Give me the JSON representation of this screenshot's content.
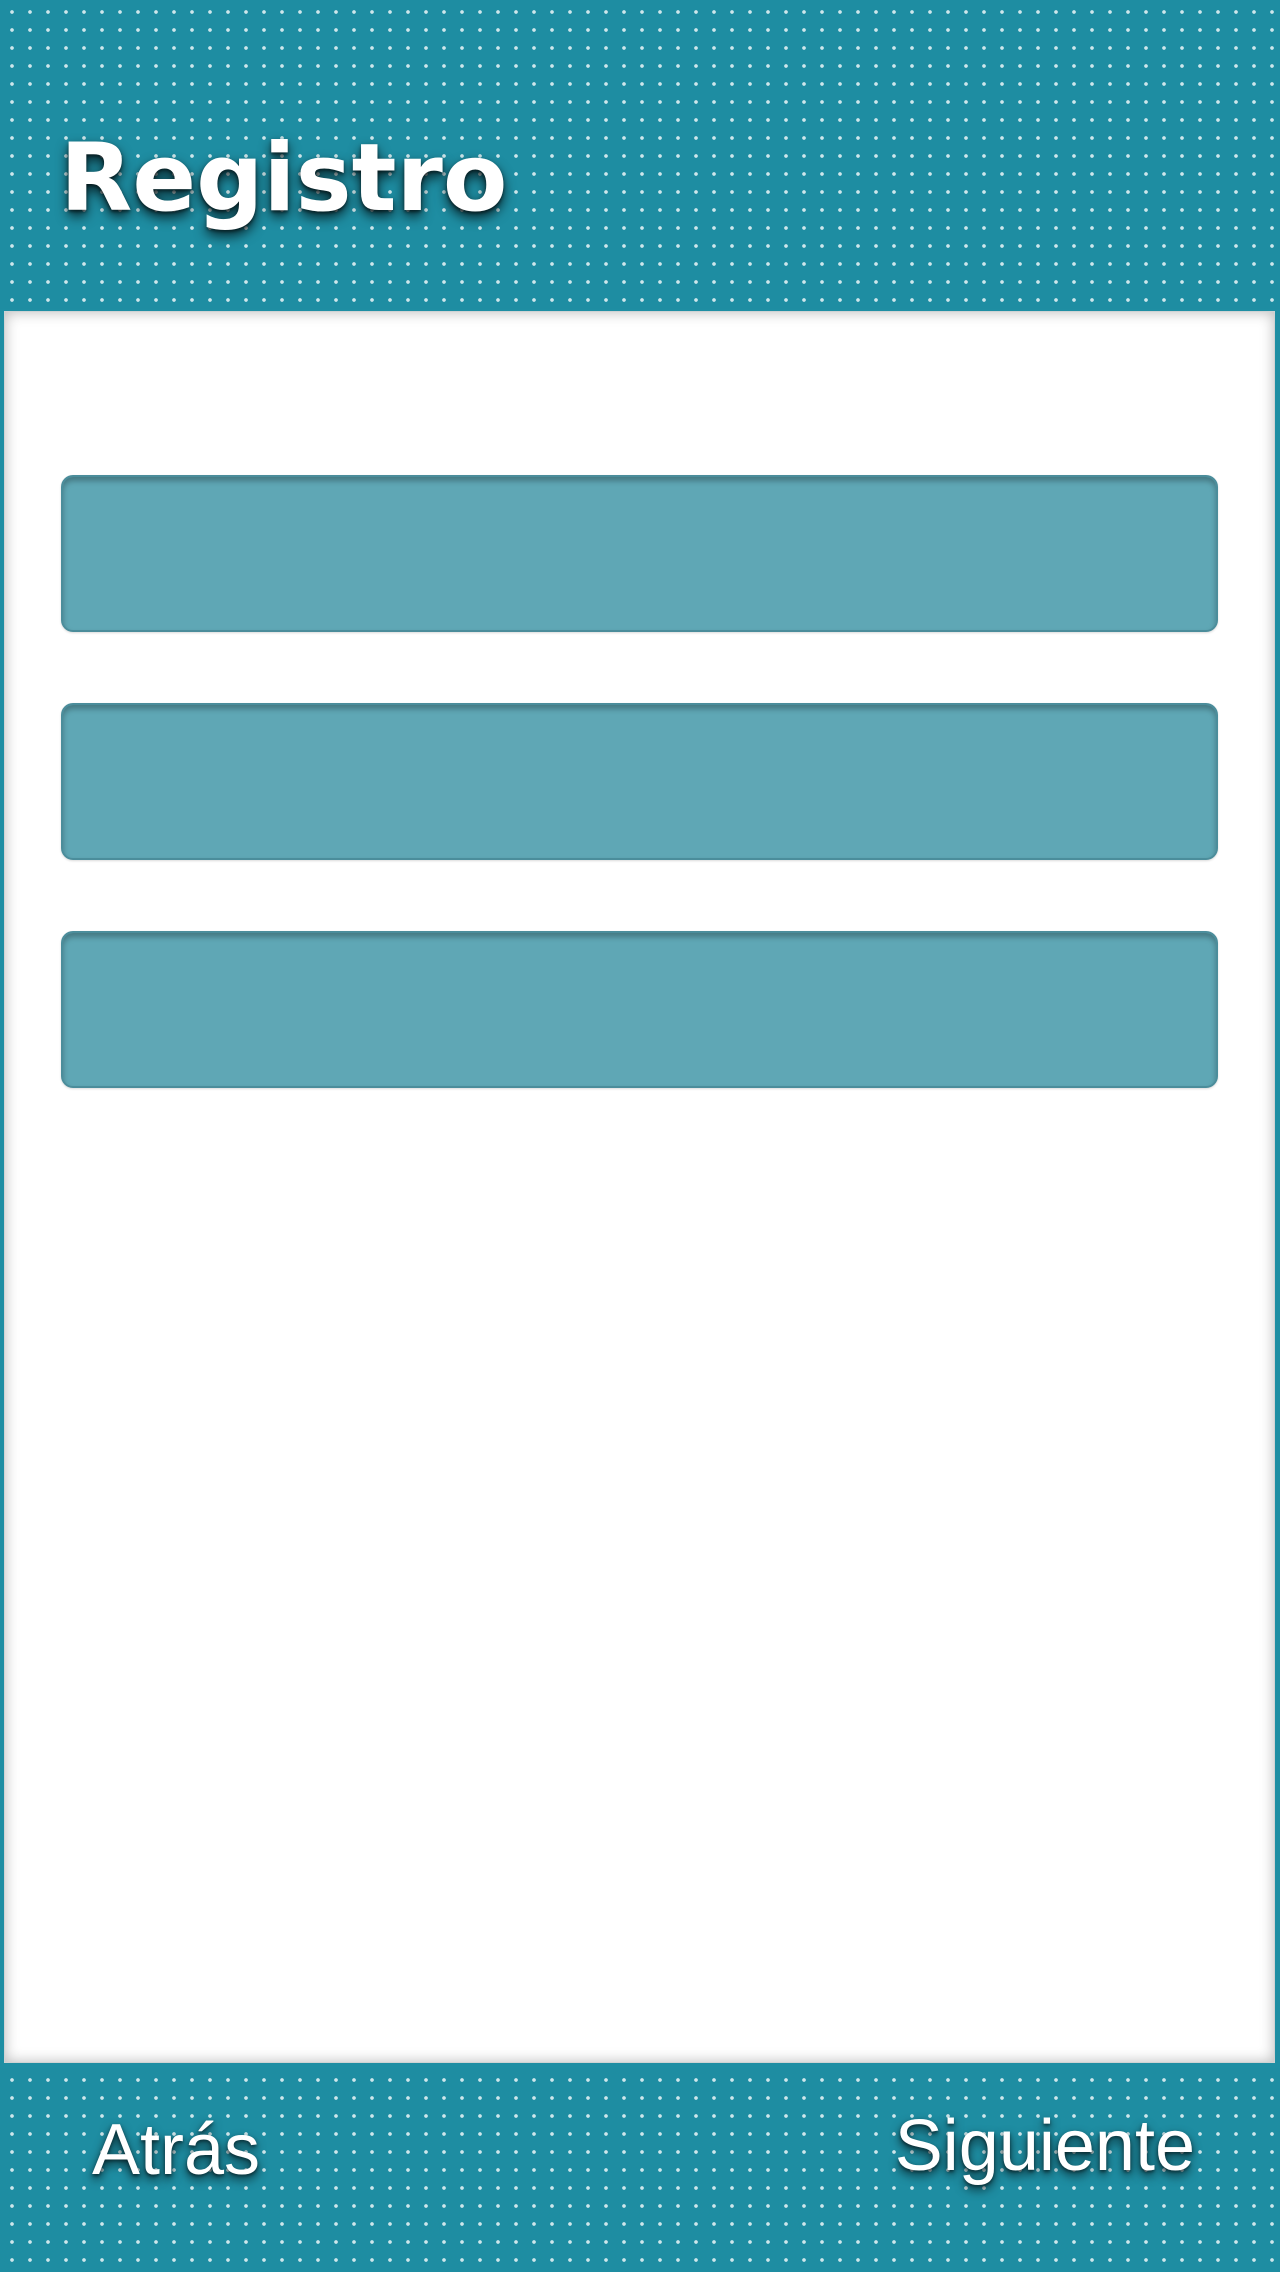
{
  "header": {
    "title": "Registro"
  },
  "form": {
    "fields": [
      {
        "value": "",
        "placeholder": ""
      },
      {
        "value": "",
        "placeholder": ""
      },
      {
        "value": "",
        "placeholder": ""
      }
    ]
  },
  "footer": {
    "back_label": "Atrás",
    "next_label": "Siguiente"
  },
  "colors": {
    "bar_background": "#1e8da2",
    "field_fill": "#5fa7b5",
    "panel_background": "#ffffff",
    "text": "#ffffff"
  }
}
